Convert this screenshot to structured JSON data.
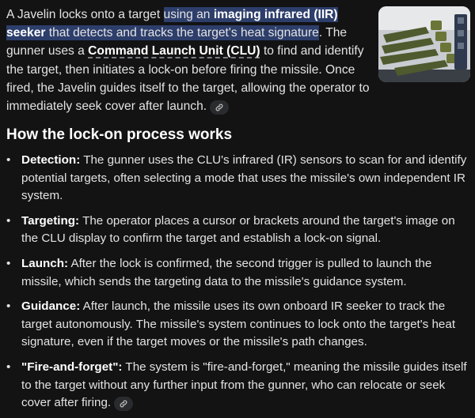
{
  "intro": {
    "lead": "A Javelin locks onto a target ",
    "highlight_pre": "using an ",
    "highlight_bold": "imaging infrared (IIR) seeker",
    "highlight_post": " that detects and tracks the target's heat signature",
    "after_highlight": ". The gunner uses a ",
    "clu_term": "Command Launch Unit (CLU)",
    "rest": " to find and identify the target, then initiates a lock-on before firing the missile. Once fired, the Javelin guides itself to the target, allowing the operator to immediately seek cover after launch."
  },
  "heading": "How the lock-on process works",
  "steps": [
    {
      "term": "Detection:",
      "text": " The gunner uses the CLU's infrared (IR) sensors to scan for and identify potential targets, often selecting a mode that uses the missile's own independent IR system."
    },
    {
      "term": "Targeting:",
      "text": " The operator places a cursor or brackets around the target's image on the CLU display to confirm the target and establish a lock-on signal."
    },
    {
      "term": "Launch:",
      "text": " After the lock is confirmed, the second trigger is pulled to launch the missile, which sends the targeting data to the missile's guidance system."
    },
    {
      "term": "Guidance:",
      "text": " After launch, the missile uses its own onboard IR seeker to track the target autonomously. The missile's system continues to lock onto the target's heat signature, even if the target moves or the missile's path changes."
    },
    {
      "term": "\"Fire-and-forget\":",
      "text": " The system is \"fire-and-forget,\" meaning the missile guides itself to the target without any further input from the gunner, who can relocate or seek cover after firing."
    }
  ],
  "bullet": "•",
  "icons": {
    "source_link": "link-icon",
    "thumbnail": "javelin-missiles-thumbnail"
  },
  "colors": {
    "background": "#131314",
    "highlight": "#2d3e6b",
    "text": "#e3e3e3",
    "chip": "#2a2b2e"
  }
}
